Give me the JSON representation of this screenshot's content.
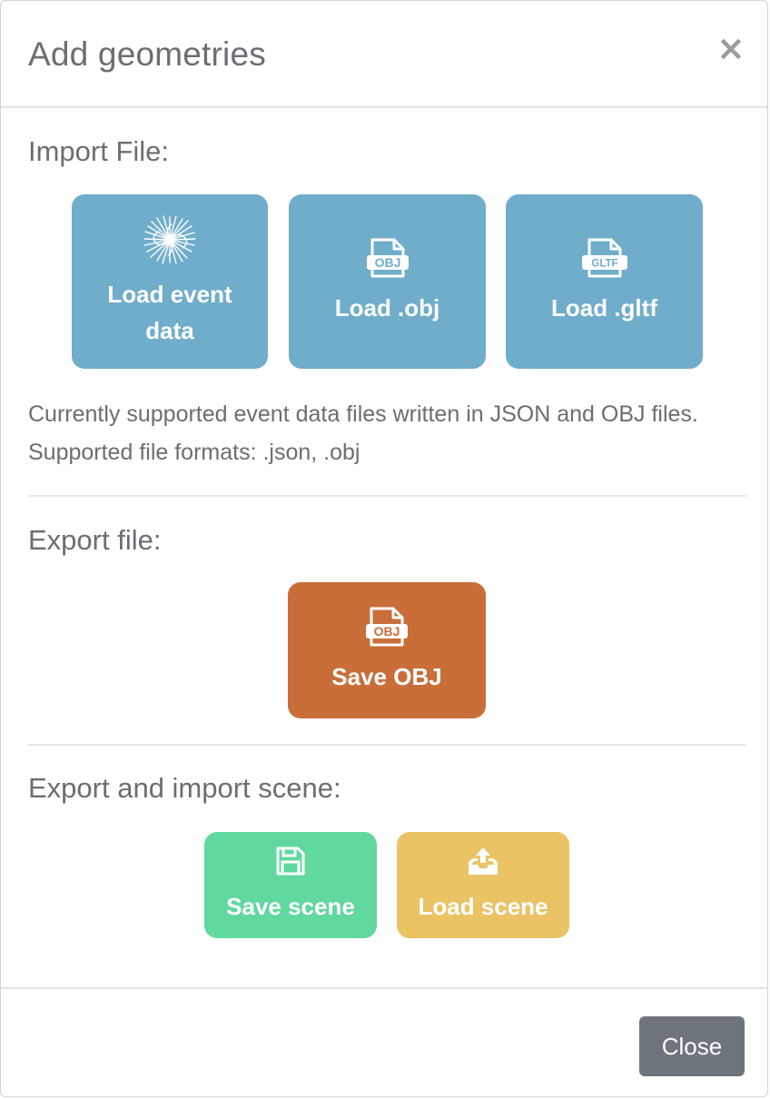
{
  "modal": {
    "title": "Add geometries",
    "close_symbol": "×"
  },
  "import_section": {
    "title": "Import File:",
    "buttons": [
      {
        "label": "Load event data",
        "icon": "burst-icon",
        "color": "#6fadcb"
      },
      {
        "label": "Load .obj",
        "icon": "obj-file-icon",
        "icon_text": "OBJ",
        "color": "#6fadcb"
      },
      {
        "label": "Load .gltf",
        "icon": "gltf-file-icon",
        "icon_text": "GLTF",
        "color": "#6fadcb"
      }
    ],
    "help_text": "Currently supported event data files written in JSON and OBJ files. Supported file formats: .json, .obj"
  },
  "export_section": {
    "title": "Export file:",
    "button": {
      "label": "Save OBJ",
      "icon": "obj-file-icon",
      "icon_text": "OBJ",
      "color": "#c96e39"
    }
  },
  "scene_section": {
    "title": "Export and import scene:",
    "buttons": [
      {
        "label": "Save scene",
        "icon": "floppy-disk-icon",
        "color": "#60d8a0"
      },
      {
        "label": "Load scene",
        "icon": "upload-tray-icon",
        "color": "#e9c364"
      }
    ]
  },
  "footer": {
    "close_label": "Close",
    "close_color": "#6d747c"
  }
}
